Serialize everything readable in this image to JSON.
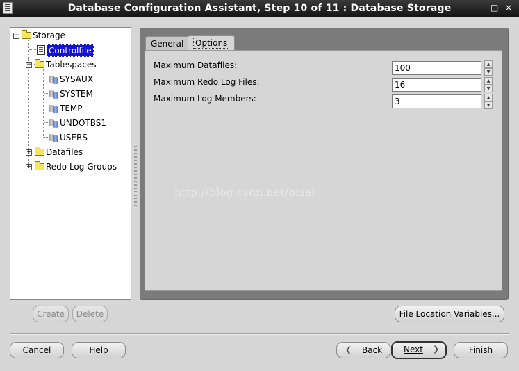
{
  "window": {
    "title": "Database Configuration Assistant, Step 10 of 11 : Database Storage",
    "minimize": "–",
    "maximize": "□",
    "close": "×"
  },
  "tree": {
    "root": "Storage",
    "controlfile": "Controlfile",
    "tablespaces": "Tablespaces",
    "tablespace_items": [
      "SYSAUX",
      "SYSTEM",
      "TEMP",
      "UNDOTBS1",
      "USERS"
    ],
    "datafiles": "Datafiles",
    "redo_log_groups": "Redo Log Groups"
  },
  "tabs": {
    "general": "General",
    "options": "Options",
    "active": "Options"
  },
  "options": {
    "max_datafiles_label": "Maximum Datafiles:",
    "max_datafiles_value": "100",
    "max_redo_label": "Maximum Redo Log Files:",
    "max_redo_value": "16",
    "max_log_members_label": "Maximum Log Members:",
    "max_log_members_value": "3"
  },
  "watermark": "http://blog.csdn.net/bisal",
  "buttons": {
    "create": "Create",
    "delete": "Delete",
    "file_location": "File Location Variables...",
    "cancel": "Cancel",
    "help": "Help",
    "back": "Back",
    "next": "Next",
    "finish": "Finish"
  },
  "colors": {
    "selection": "#1212d8",
    "titlebar": "#1e1e1e",
    "frame": "#7b7b7b"
  }
}
